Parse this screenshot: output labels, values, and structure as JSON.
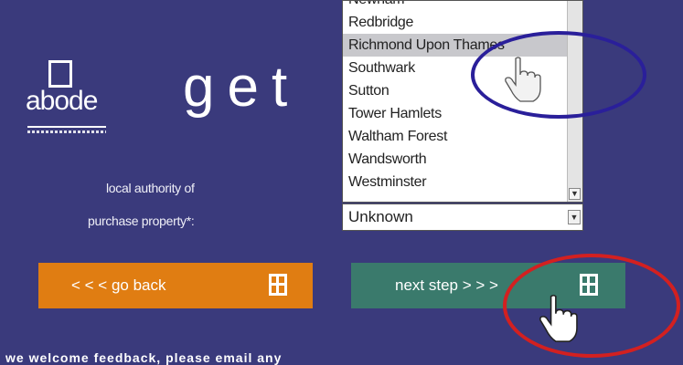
{
  "logo": {
    "text": "abode"
  },
  "headline": "get",
  "form": {
    "label_line1": "local authority of",
    "label_line2": "purchase property*:",
    "list_options": [
      "Newham",
      "Redbridge",
      "Richmond Upon Thames",
      "Southwark",
      "Sutton",
      "Tower Hamlets",
      "Waltham Forest",
      "Wandsworth",
      "Westminster"
    ],
    "selected_index": 2,
    "select_value": "Unknown"
  },
  "buttons": {
    "back": "< < < go back",
    "next": "next step > > >"
  },
  "footer_text": "we welcome feedback, please email any",
  "colors": {
    "background": "#3a3a7c",
    "back_button": "#e07d12",
    "next_button": "#3a7a6c",
    "highlight_ring_blue": "#2a1f9a",
    "highlight_ring_red": "#d32020"
  },
  "icons": {
    "scroll_arrow": "chevron-down-icon",
    "button_icon": "window-icon",
    "cursor": "hand-pointer-icon"
  }
}
